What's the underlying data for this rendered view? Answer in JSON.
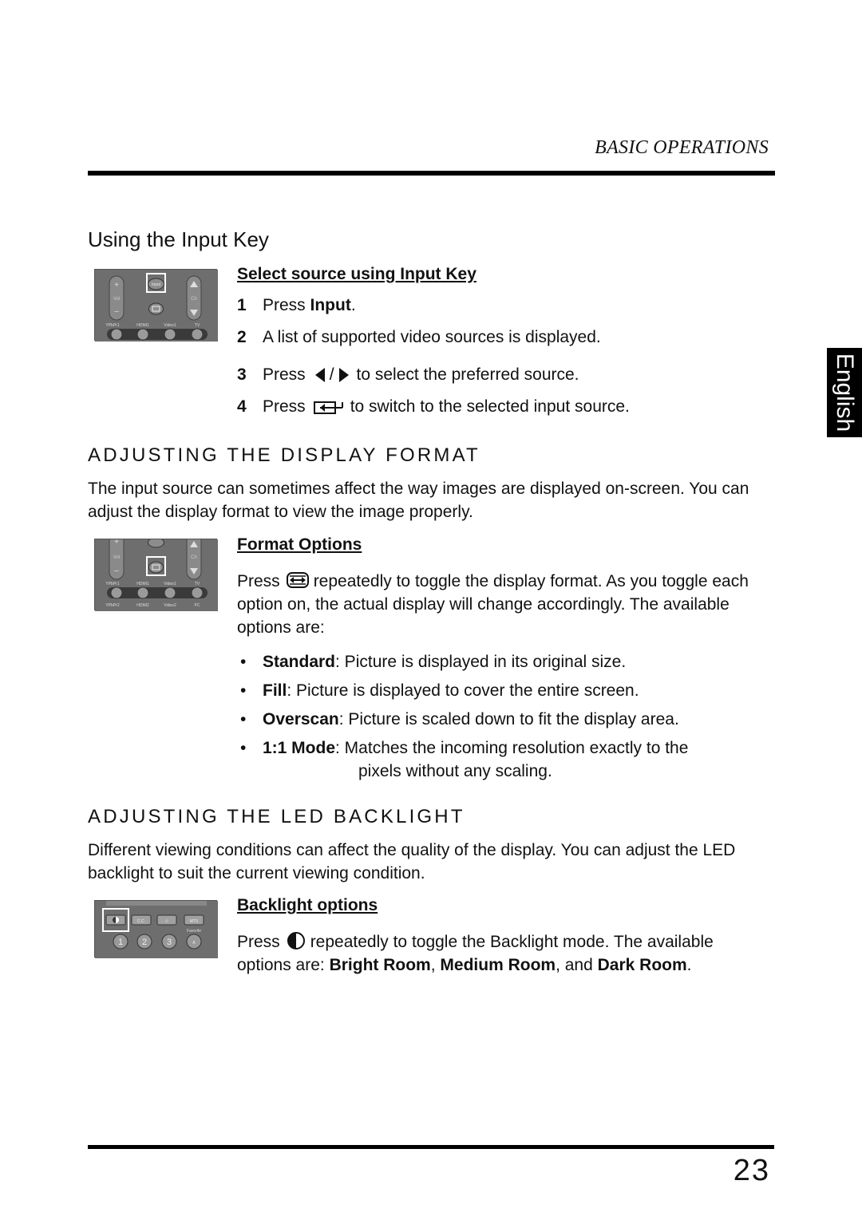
{
  "header": {
    "section_title": "BASIC OPERATIONS"
  },
  "language_tab": "English",
  "page_number": "23",
  "input_key": {
    "title": "Using the Input Key",
    "subheading": "Select source using Input Key",
    "steps": [
      {
        "num": "1",
        "pre": "Press ",
        "bold": "Input",
        "post": "."
      },
      {
        "num": "2",
        "text": "A list of supported video sources is displayed."
      },
      {
        "num": "3",
        "pre": "Press",
        "sep": "/",
        "post": "to select the preferred source.",
        "icons": [
          "arrow-left-icon",
          "arrow-right-icon"
        ]
      },
      {
        "num": "4",
        "pre": "Press",
        "post": "to switch to the selected input source.",
        "icons": [
          "enter-icon"
        ]
      }
    ],
    "remote": {
      "labels": [
        "YPbPr1",
        "HDMI1",
        "Video1",
        "TV"
      ],
      "vol": "Vol",
      "ch": "Ch",
      "input": "Input"
    }
  },
  "display_format": {
    "title": "ADJUSTING THE DISPLAY FORMAT",
    "intro": "The input source can sometimes affect the way images are displayed on-screen. You can adjust the display format to view the image properly.",
    "subheading": "Format Options",
    "desc_pre": "Press",
    "desc_post": "repeatedly to toggle the display format. As you toggle each option on, the actual display will change accordingly. The available options are:",
    "options": [
      {
        "name": "Standard",
        "desc": ": Picture is displayed in its original size."
      },
      {
        "name": "Fill",
        "desc": ": Picture is displayed to cover the entire screen."
      },
      {
        "name": "Overscan",
        "desc": ": Picture is scaled down to fit the display area."
      },
      {
        "name": "1:1 Mode",
        "desc": ": Matches the incoming resolution exactly to the",
        "cont": "pixels without any scaling."
      }
    ],
    "remote": {
      "labels_top": [
        "YPbPr1",
        "HDMI1",
        "Video1",
        "TV"
      ],
      "labels_bottom": [
        "YPbPr2",
        "HDMI2",
        "Video2",
        "PC"
      ]
    }
  },
  "backlight": {
    "title": "ADJUSTING THE LED BACKLIGHT",
    "intro": "Different viewing conditions can affect the quality of the display. You can adjust the LED backlight to suit the current viewing condition.",
    "subheading": "Backlight options",
    "desc_pre": "Press",
    "desc_mid": "repeatedly to toggle the Backlight mode. The available options are: ",
    "modes": [
      "Bright Room",
      "Medium Room",
      "Dark Room"
    ],
    "sep1": ", ",
    "sep2": ", and ",
    "end": ".",
    "remote": {
      "buttons": [
        "",
        "C.C.",
        "-/-",
        "MTS"
      ],
      "favorite": "Favorite",
      "digits": [
        "1",
        "2",
        "3",
        "A"
      ]
    }
  }
}
